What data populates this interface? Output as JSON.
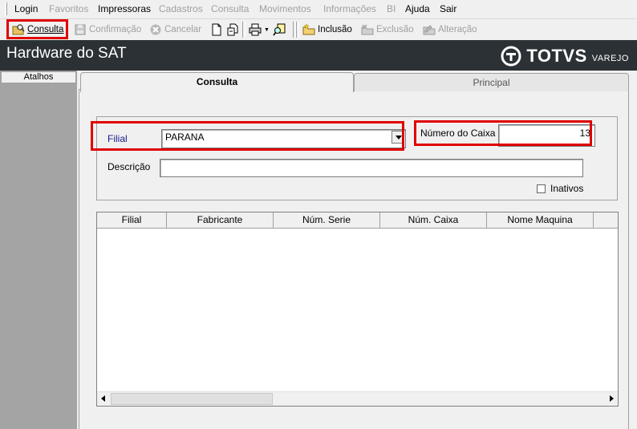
{
  "menu": {
    "items": [
      {
        "label": "Login",
        "enabled": true
      },
      {
        "label": "Favoritos",
        "enabled": false
      },
      {
        "label": "Impressoras",
        "enabled": true
      },
      {
        "label": "Cadastros",
        "enabled": false
      },
      {
        "label": "Consulta",
        "enabled": false
      },
      {
        "label": "Movimentos",
        "enabled": false
      },
      {
        "label": "Informações",
        "enabled": false
      },
      {
        "label": "BI",
        "enabled": false
      },
      {
        "label": "Ajuda",
        "enabled": true
      },
      {
        "label": "Sair",
        "enabled": true
      }
    ]
  },
  "toolbar": {
    "consulta": "Consulta",
    "confirmacao": "Confirmação",
    "cancelar": "Cancelar",
    "inclusao": "Inclusão",
    "exclusao": "Exclusão",
    "alteracao": "Alteração"
  },
  "window": {
    "title": "Hardware do SAT",
    "brand": "TOTVS",
    "brand_sub": "VAREJO"
  },
  "sidebar": {
    "atalhos": "Atalhos"
  },
  "tabs": [
    {
      "label": "Consulta",
      "active": true
    },
    {
      "label": "Principal",
      "active": false
    }
  ],
  "form": {
    "filial_label": "Filial",
    "filial_value": "PARANA",
    "numero_caixa_label": "Número do Caixa",
    "numero_caixa_value": "13",
    "descricao_label": "Descrição",
    "descricao_value": "",
    "inativos_label": "Inativos",
    "inativos_checked": false
  },
  "grid": {
    "columns": [
      "Filial",
      "Fabricante",
      "Núm. Serie",
      "Núm. Caixa",
      "Nome Maquina"
    ],
    "rows": []
  },
  "colors": {
    "titlebar": "#2b3134",
    "highlight": "#e00000",
    "label_blue": "#1a1a8a"
  }
}
